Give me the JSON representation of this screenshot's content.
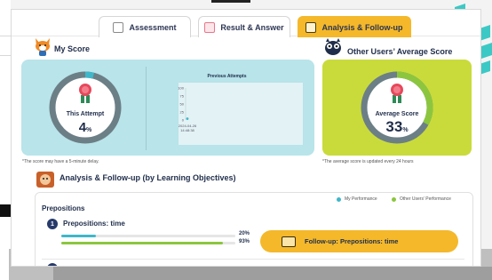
{
  "tabs": [
    {
      "label": "Assessment",
      "icon": "assessment-icon",
      "active": false
    },
    {
      "label": "Result & Answer",
      "icon": "result-icon",
      "active": false
    },
    {
      "label": "Analysis & Follow-up",
      "icon": "analysis-icon",
      "active": true
    }
  ],
  "my_score": {
    "title": "My Score",
    "label": "This Attempt",
    "value": "4",
    "unit": "%",
    "gauge_fraction": 0.04,
    "note": "*The score may have a 5-minute delay."
  },
  "previous_attempts": {
    "title": "Previous Attempts",
    "chart_data": {
      "type": "scatter",
      "title": "Previous Attempts",
      "y_ticks": [
        "100",
        "75",
        "50",
        "25",
        "0"
      ],
      "ylim": [
        0,
        100
      ],
      "x_labels": [
        "2024-04-26\n14:48:38"
      ],
      "points": [
        {
          "x": "2024-04-26 14:48:38",
          "y": 4
        }
      ]
    }
  },
  "other_users": {
    "title": "Other Users’  Average Score",
    "label": "Average Score",
    "value": "33",
    "unit": "%",
    "gauge_fraction": 0.33,
    "note": "*The average score is updated every 24 hours"
  },
  "analysis": {
    "title": "Analysis & Follow-up (by Learning Objectives)",
    "legend_my": "My Performance",
    "legend_others": "Other Users’  Performance",
    "topic": "Prepositions",
    "objectives": [
      {
        "number": "1",
        "name": "Prepositions: time",
        "my_pct": "20%",
        "others_pct": "93%",
        "my_value": 0.2,
        "others_value": 0.93,
        "follow_up_label": "Follow-up: Prepositions: time"
      }
    ]
  },
  "colors": {
    "my_performance": "#3fb7c9",
    "others_performance": "#8cc63f",
    "accent": "#f4b82a",
    "my_panel": "#b8e4ea",
    "other_panel": "#c9db3b"
  }
}
